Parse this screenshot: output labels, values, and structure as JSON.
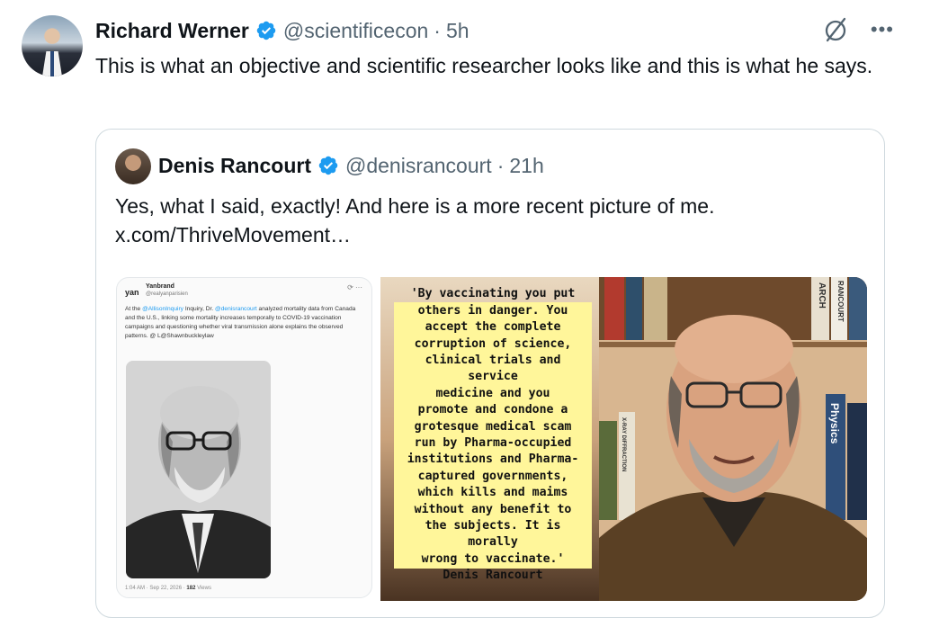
{
  "post": {
    "author_name": "Richard Werner",
    "author_handle": "@scientificecon",
    "separator": "·",
    "time": "5h",
    "text": "This is what an objective and scientific researcher looks like and this is what he says.",
    "more_label": "•••",
    "icons": {
      "verified": "verified-badge-icon",
      "grok": "grok-icon",
      "more": "more-icon"
    }
  },
  "quoted": {
    "author_name": "Denis Rancourt",
    "author_handle": "@denisrancourt",
    "separator": "·",
    "time": "21h",
    "text": "Yes, what I said, exactly! And here is  a more recent picture of me.",
    "link": "x.com/ThriveMovement…",
    "media_left": {
      "logo": "yan",
      "account_name": "Yanbrand",
      "account_handle": "@realyanparisien",
      "icons": "⟳ ···",
      "text_parts": [
        {
          "t": "At the ",
          "blue": false
        },
        {
          "t": "@AllisonInquiry",
          "blue": true
        },
        {
          "t": " Inquiry, Dr. ",
          "blue": false
        },
        {
          "t": "@denisrancourt",
          "blue": true
        },
        {
          "t": " analyzed mortality data from Canada and the U.S., linking some mortality increases temporally to COVID-19 vaccination campaigns and questioning whether viral transmission alone explains the observed patterns. @ L@Shawnbuckleylaw",
          "blue": false
        }
      ],
      "footer_time": "1:04 AM · Sep 22, 2026 ·",
      "footer_views_count": "182",
      "footer_views_label": "Views"
    },
    "media_right": {
      "quote_lines": [
        "'By vaccinating you put",
        "others in danger. You",
        "accept the complete",
        "corruption of science,",
        "clinical trials and service",
        "medicine and you",
        "promote and condone a",
        "grotesque medical scam",
        "run by Pharma-occupied",
        "institutions and Pharma-",
        "captured governments,",
        "which kills and maims",
        "without any benefit to",
        "the subjects. It is morally",
        "wrong to vaccinate.'",
        "Denis Rancourt"
      ],
      "book_spines": [
        "ARCH",
        "RANCOURT",
        "Physics",
        "X-RAY DIFFRACTION"
      ]
    }
  },
  "colors": {
    "verified_blue": "#1d9bf0",
    "muted_gray": "#536471",
    "quote_yellow": "#fff69a",
    "border": "#cfd9de"
  }
}
